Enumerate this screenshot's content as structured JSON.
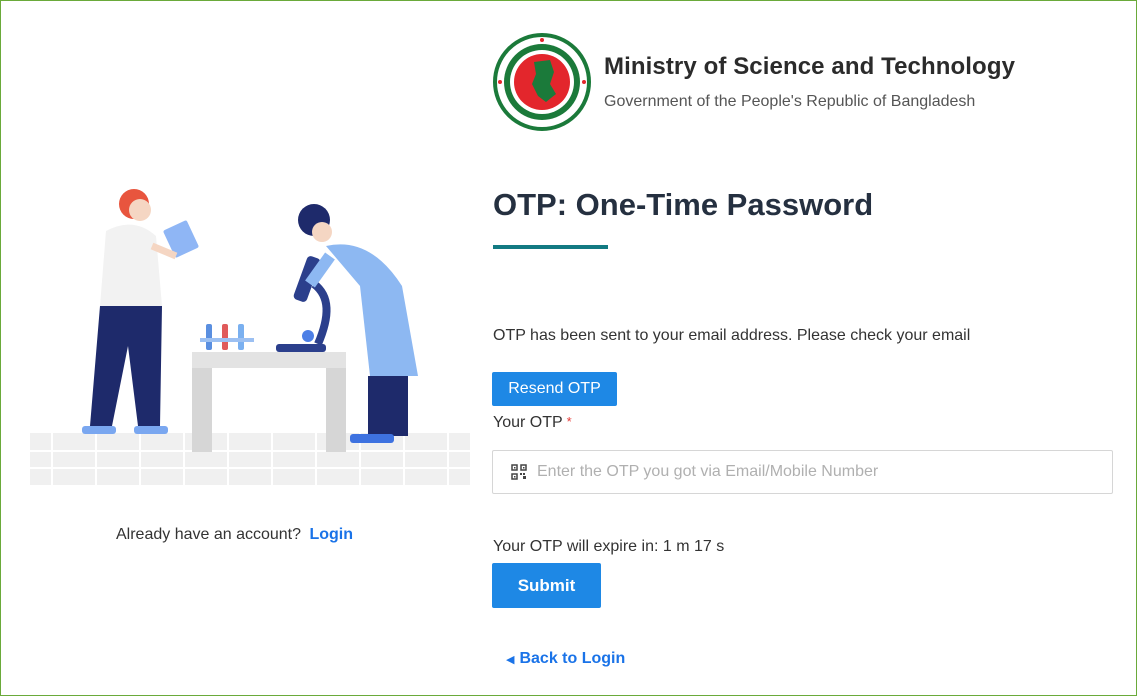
{
  "brand": {
    "title": "Ministry of Science and Technology",
    "subtitle": "Government of the People's Republic of Bangladesh",
    "seal_icon": "bangladesh-government-seal"
  },
  "form": {
    "title": "OTP: One-Time Password",
    "otp_sent_message": "OTP has been sent to your email address. Please check your email",
    "resend_label": "Resend OTP",
    "otp_label": "Your OTP",
    "required_marker": "*",
    "otp_placeholder": "Enter the OTP you got via Email/Mobile Number",
    "otp_value": "",
    "field_icon": "qr-code-icon",
    "expire_text": "Your OTP will expire in: 1 m 17 s",
    "submit_label": "Submit",
    "back_label": "Back to Login",
    "back_icon": "caret-left-icon"
  },
  "account": {
    "prompt": "Already have an account?",
    "login_label": "Login"
  },
  "colors": {
    "primary": "#1e88e5",
    "link": "#1a73e8",
    "accent_underline": "#127a82",
    "frame_border": "#6aaa3a",
    "required": "#e53935"
  }
}
